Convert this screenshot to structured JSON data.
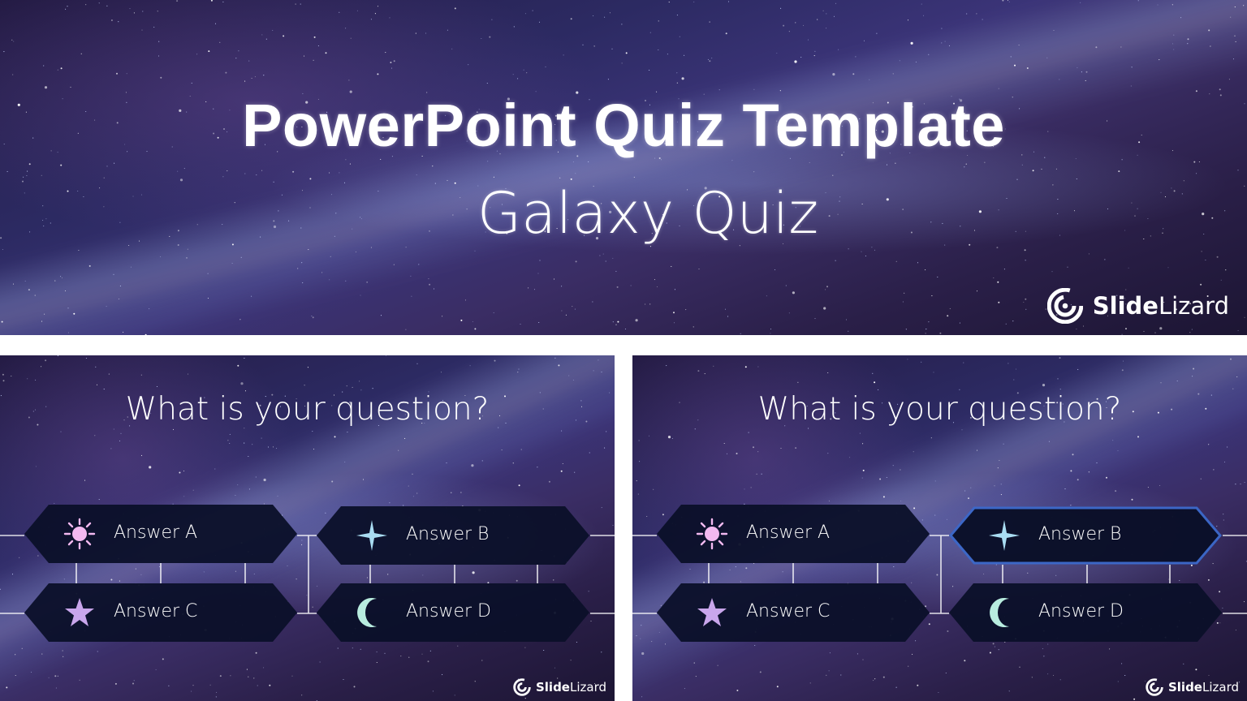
{
  "hero": {
    "title": "PowerPoint Quiz Template",
    "subtitle": "Galaxy Quiz",
    "brand": {
      "name_bold": "Slide",
      "name_regular": "Lizard",
      "logo_icon": "spiral-logo-icon"
    }
  },
  "slides": [
    {
      "question": "What is your question?",
      "highlighted_answer": null,
      "answers": [
        {
          "label": "Answer A",
          "icon": "sun-icon",
          "icon_color": "#f3b9f0"
        },
        {
          "label": "Answer B",
          "icon": "sparkle-star-icon",
          "icon_color": "#a9dcf2"
        },
        {
          "label": "Answer C",
          "icon": "star-icon",
          "icon_color": "#c9a6ec"
        },
        {
          "label": "Answer D",
          "icon": "crescent-moon-icon",
          "icon_color": "#b8ecdf"
        }
      ],
      "brand": {
        "name_bold": "Slide",
        "name_regular": "Lizard"
      }
    },
    {
      "question": "What is your question?",
      "highlighted_answer": "Answer B",
      "answers": [
        {
          "label": "Answer A",
          "icon": "sun-icon",
          "icon_color": "#f3b9f0"
        },
        {
          "label": "Answer B",
          "icon": "sparkle-star-icon",
          "icon_color": "#a9dcf2"
        },
        {
          "label": "Answer C",
          "icon": "star-icon",
          "icon_color": "#c9a6ec"
        },
        {
          "label": "Answer D",
          "icon": "crescent-moon-icon",
          "icon_color": "#b8ecdf"
        }
      ],
      "brand": {
        "name_bold": "Slide",
        "name_regular": "Lizard"
      }
    }
  ],
  "colors": {
    "answer_fill": "#0b1029",
    "highlight_glow": "#3c68c8",
    "text": "#ffffff",
    "divider": "#ffffff"
  }
}
